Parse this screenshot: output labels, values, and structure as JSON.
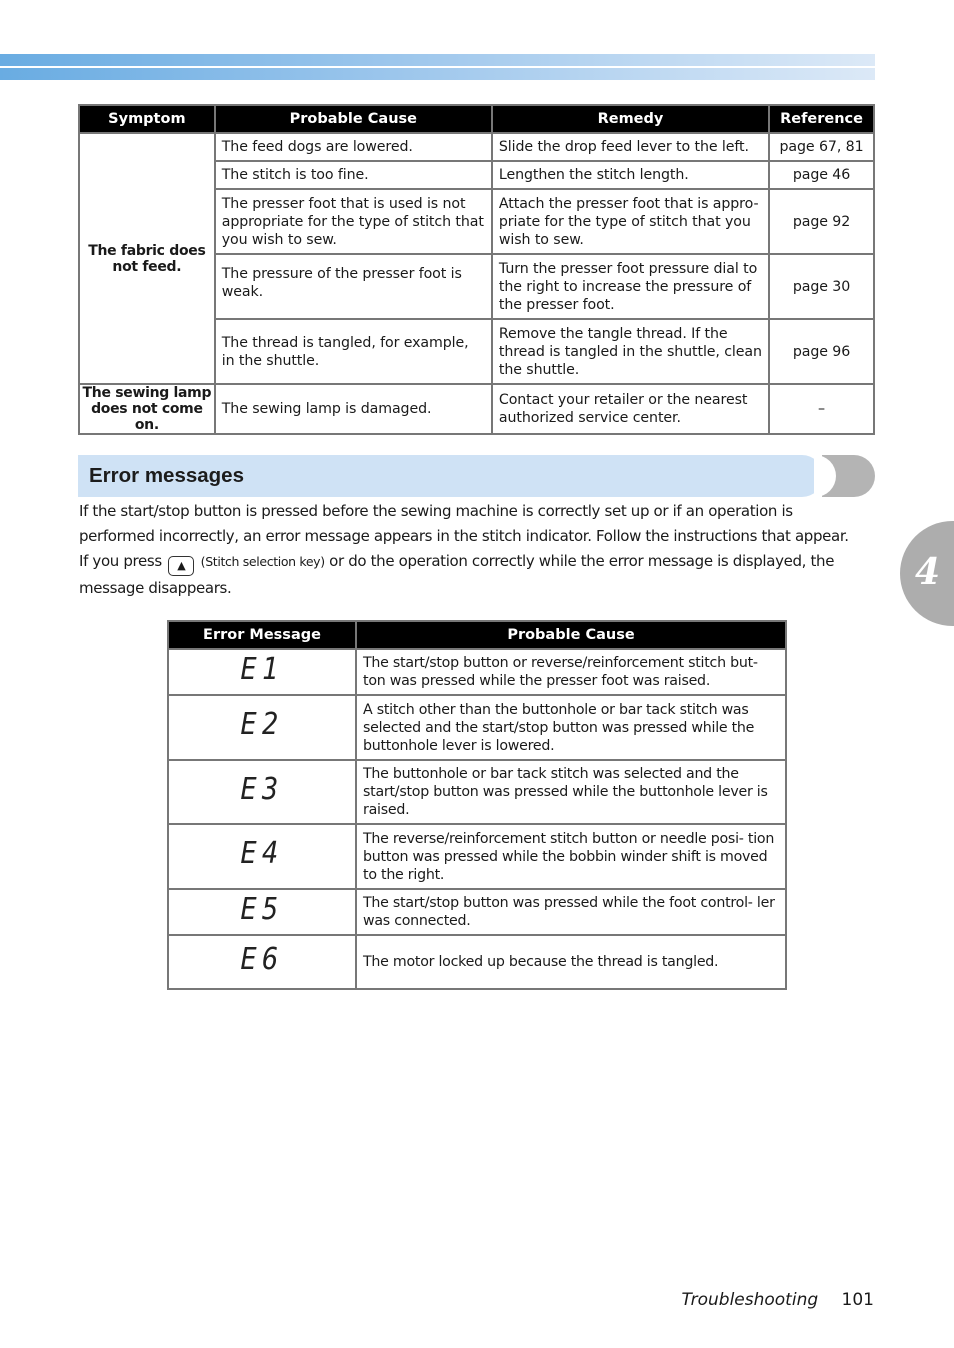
{
  "header_band": {
    "colors": [
      "#69ace2",
      "#dce9f7"
    ]
  },
  "trouble_table": {
    "headers": [
      "Symptom",
      "Probable Cause",
      "Remedy",
      "Reference"
    ],
    "groups": [
      {
        "symptom": "The fabric does not feed.",
        "rows": [
          {
            "cause": "The feed dogs are lowered.",
            "remedy": "Slide the drop feed lever to the left.",
            "reference": "page 67, 81"
          },
          {
            "cause": "The stitch is too fine.",
            "remedy": "Lengthen the stitch length.",
            "reference": "page 46"
          },
          {
            "cause": "The presser foot that is used is not appropriate for the type of stitch that you wish to sew.",
            "remedy": "Attach the presser foot that is appro- priate for the type of stitch that you wish to sew.",
            "reference": "page 92"
          },
          {
            "cause": "The pressure of the presser foot is weak.",
            "remedy": "Turn the presser foot pressure dial to the right to increase the pressure of the presser foot.",
            "reference": "page 30"
          },
          {
            "cause": "The thread is tangled, for example, in the shuttle.",
            "remedy": "Remove the tangle thread. If the thread is tangled in the shuttle, clean the shuttle.",
            "reference": "page 96"
          }
        ]
      },
      {
        "symptom": "The sewing lamp does not come on.",
        "rows": [
          {
            "cause": "The sewing lamp is damaged.",
            "remedy": "Contact your retailer or the nearest authorized service center.",
            "reference": "–"
          }
        ]
      }
    ]
  },
  "section": {
    "title": "Error messages",
    "para1": "If the start/stop button is pressed before the sewing machine is correctly set up or if an operation is performed incorrectly, an error message appears in the stitch indicator. Follow the instructions that appear.",
    "para2_before": "If you press",
    "key_icon": "▲",
    "key_label": "(Stitch selection key)",
    "para2_after": "or do the operation correctly while the error message is displayed, the message disappears."
  },
  "chapter_tab": {
    "number": "4",
    "color": "#adadad"
  },
  "error_table": {
    "headers": [
      "Error Message",
      "Probable Cause"
    ],
    "rows": [
      {
        "code": "E1",
        "cause": "The start/stop button or reverse/reinforcement stitch but- ton was pressed while the presser foot was raised."
      },
      {
        "code": "E2",
        "cause": "A stitch other than the buttonhole or bar tack stitch was selected and the start/stop button was pressed while the buttonhole lever is lowered."
      },
      {
        "code": "E3",
        "cause": "The buttonhole or bar tack stitch was selected and the start/stop button was pressed while the buttonhole lever is raised."
      },
      {
        "code": "E4",
        "cause": "The reverse/reinforcement stitch button or needle posi- tion button was pressed while the bobbin winder shift is moved to the right."
      },
      {
        "code": "E5",
        "cause": "The start/stop button was pressed while the foot control- ler was connected."
      },
      {
        "code": "E6",
        "cause": "The motor locked up because the thread is tangled."
      }
    ]
  },
  "footer": {
    "section": "Troubleshooting",
    "page": "101"
  }
}
